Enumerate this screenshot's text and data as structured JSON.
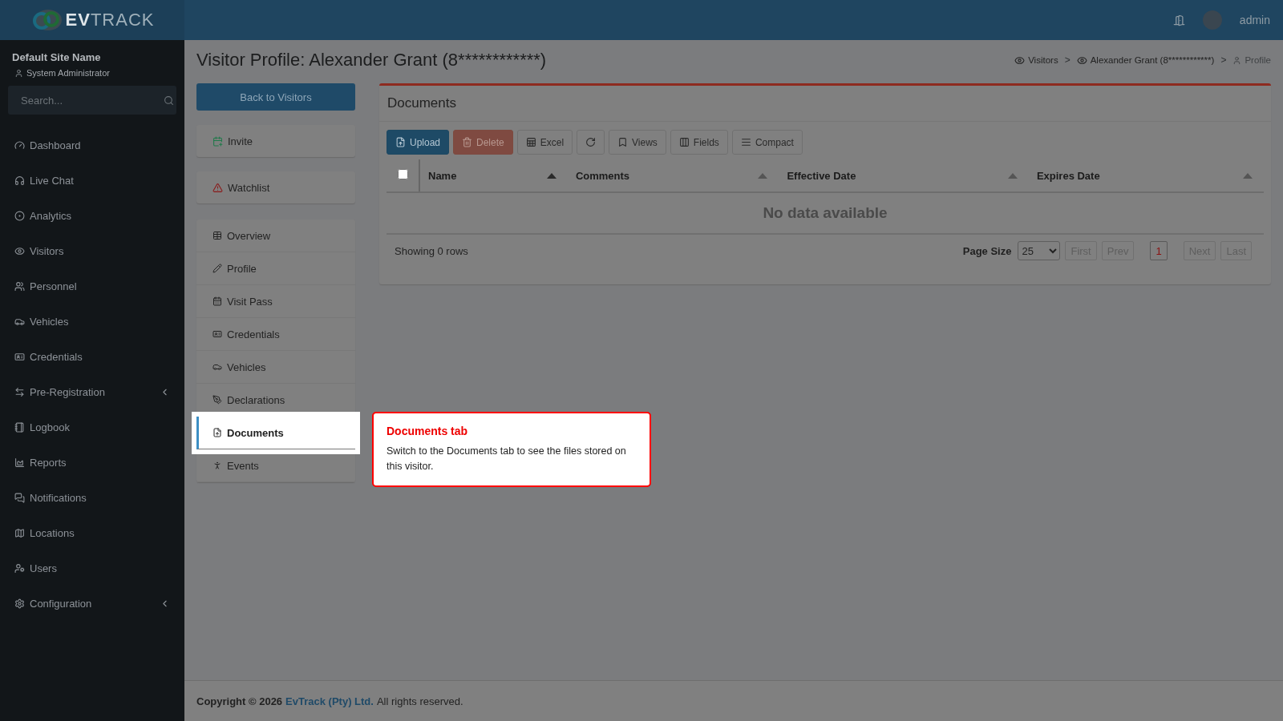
{
  "header": {
    "logo_bold": "EV",
    "logo_light": "TRACK",
    "user": "admin"
  },
  "sidebar": {
    "site": "Default Site Name",
    "role": "System Administrator",
    "search": {
      "placeholder": "Search..."
    },
    "items": [
      {
        "label": "Dashboard",
        "has_submenu": false
      },
      {
        "label": "Live Chat",
        "has_submenu": false
      },
      {
        "label": "Analytics",
        "has_submenu": false
      },
      {
        "label": "Visitors",
        "has_submenu": false
      },
      {
        "label": "Personnel",
        "has_submenu": false
      },
      {
        "label": "Vehicles",
        "has_submenu": false
      },
      {
        "label": "Credentials",
        "has_submenu": false
      },
      {
        "label": "Pre-Registration",
        "has_submenu": true
      },
      {
        "label": "Logbook",
        "has_submenu": false
      },
      {
        "label": "Reports",
        "has_submenu": false
      },
      {
        "label": "Notifications",
        "has_submenu": false
      },
      {
        "label": "Locations",
        "has_submenu": false
      },
      {
        "label": "Users",
        "has_submenu": false
      },
      {
        "label": "Configuration",
        "has_submenu": true
      }
    ]
  },
  "page": {
    "title": "Visitor Profile: Alexander Grant (8************)",
    "breadcrumb": [
      {
        "label": "Visitors",
        "current": false
      },
      {
        "label": "Alexander Grant (8************)",
        "current": false
      },
      {
        "label": "Profile",
        "current": true
      }
    ],
    "breadcrumb_separator": ">",
    "back_button": "Back to Visitors",
    "action_cards": [
      "Invite",
      "Watchlist"
    ],
    "tabs": [
      {
        "label": "Overview",
        "selected": false
      },
      {
        "label": "Profile",
        "selected": false
      },
      {
        "label": "Visit Pass",
        "selected": false
      },
      {
        "label": "Credentials",
        "selected": false
      },
      {
        "label": "Vehicles",
        "selected": false
      },
      {
        "label": "Declarations",
        "selected": false
      },
      {
        "label": "Documents",
        "selected": true
      },
      {
        "label": "Events",
        "selected": false
      }
    ]
  },
  "documents": {
    "title": "Documents",
    "toolbar": [
      {
        "label": "Upload",
        "kind": "primary",
        "disabled": false
      },
      {
        "label": "Delete",
        "kind": "danger",
        "disabled": true
      },
      {
        "label": "Excel",
        "kind": "plain",
        "disabled": false
      },
      {
        "kind": "refresh",
        "disabled": false
      },
      {
        "label": "Views",
        "kind": "plain",
        "disabled": false
      },
      {
        "label": "Fields",
        "kind": "plain",
        "disabled": false
      },
      {
        "label": "Compact",
        "kind": "plain",
        "disabled": false
      }
    ],
    "select_all": {
      "checked": false
    },
    "columns": [
      {
        "label": "Name",
        "sort_active": true
      },
      {
        "label": "Comments",
        "sort_active": false
      },
      {
        "label": "Effective Date",
        "sort_active": false
      },
      {
        "label": "Expires Date",
        "sort_active": false
      }
    ],
    "empty_text": "No data available",
    "status": "Showing 0 rows",
    "page_size_label": "Page Size",
    "page_size": "25",
    "pager": [
      {
        "label": "First",
        "kind": "nav",
        "disabled": true,
        "selected": false
      },
      {
        "label": "Prev",
        "kind": "nav",
        "disabled": true,
        "selected": false
      },
      {
        "label": "1",
        "kind": "page",
        "disabled": false,
        "selected": true
      },
      {
        "label": "Next",
        "kind": "nav",
        "disabled": true,
        "selected": false
      },
      {
        "label": "Last",
        "kind": "nav",
        "disabled": true,
        "selected": false
      }
    ]
  },
  "tooltip": {
    "title": "Documents tab",
    "text": "Switch to the Documents tab to see the files stored on this visitor."
  },
  "footer": {
    "prefix": "Copyright © 2026",
    "link": "EvTrack (Pty) Ltd.",
    "suffix": "All rights reserved."
  }
}
